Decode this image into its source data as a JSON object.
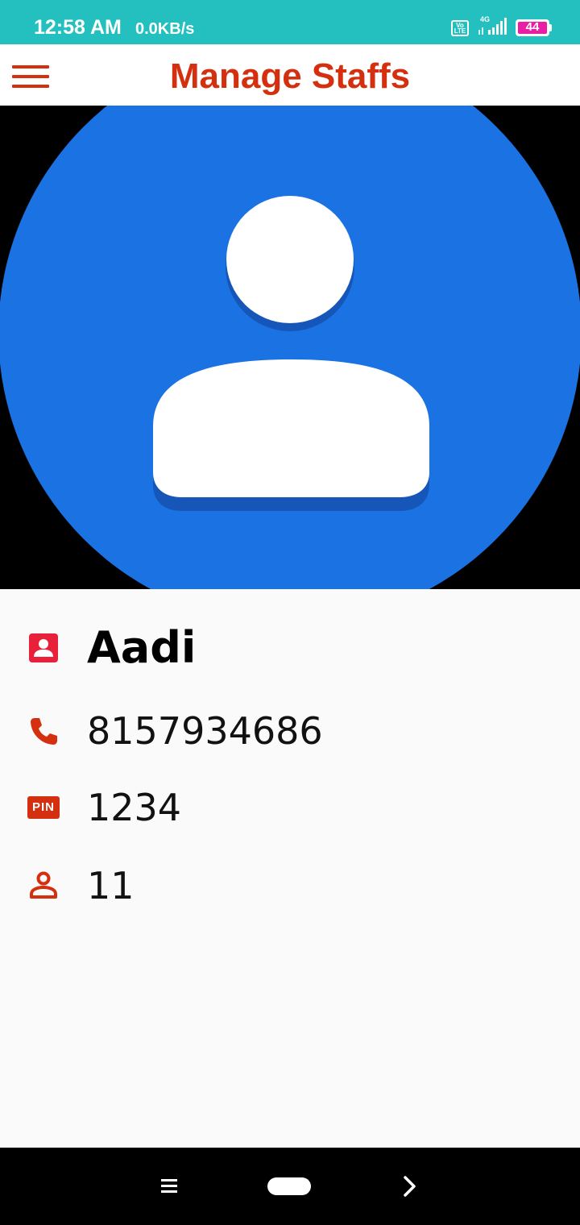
{
  "status_bar": {
    "time": "12:58 AM",
    "speed": "0.0KB/s",
    "volte": "Vo LTE",
    "network": "4G",
    "battery": "44"
  },
  "app_bar": {
    "title": "Manage Staffs",
    "menu_icon": "hamburger-menu-icon"
  },
  "avatar": {
    "icon": "person-avatar-icon",
    "circle_color": "#1a72e3",
    "background_color": "#000000"
  },
  "staff": {
    "name": "Aadi",
    "phone": "8157934686",
    "pin_label": "PIN",
    "pin": "1234",
    "id": "11"
  },
  "icons": {
    "name": "contact-card-icon",
    "phone": "phone-icon",
    "pin": "pin-icon",
    "id": "person-outline-icon"
  },
  "colors": {
    "accent": "#d4300f",
    "status_bar": "#24bfbf",
    "name_icon": "#e8203a"
  },
  "nav_bar": {
    "menu_icon": "recent-apps-icon",
    "home_icon": "home-pill-icon",
    "back_icon": "chevron-right-icon"
  }
}
